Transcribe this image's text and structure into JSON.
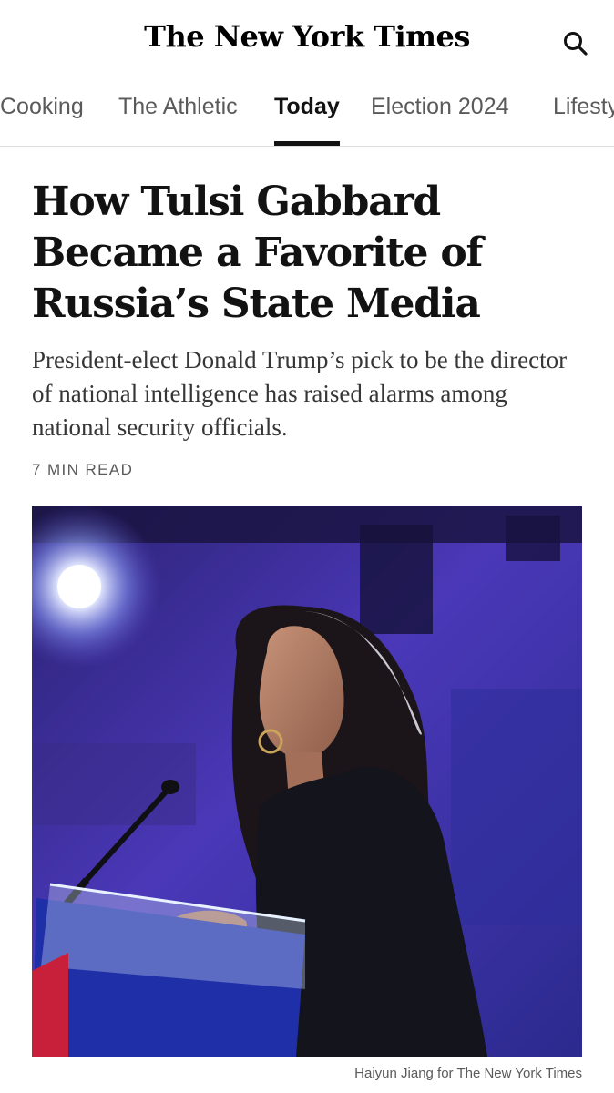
{
  "masthead": {
    "logo_text": "The New York Times",
    "search_icon": "search-icon"
  },
  "nav": {
    "tabs": [
      {
        "label": "Cooking",
        "active": false
      },
      {
        "label": "The Athletic",
        "active": false
      },
      {
        "label": "Today",
        "active": true
      },
      {
        "label": "Election 2024",
        "active": false
      },
      {
        "label": "Lifesty",
        "active": false
      }
    ]
  },
  "article": {
    "headline": "How Tulsi Gabbard Became a Favorite of Russia’s State Media",
    "summary": "President-elect Donald Trump’s pick to be the director of national intelligence has raised alarms among national security officials.",
    "read_time": "7 MIN READ",
    "photo_credit": "Haiyun Jiang for The New York Times"
  },
  "colors": {
    "text": "#121212",
    "secondary": "#5a5a5a",
    "divider": "#dcdcdc",
    "photo_background": "#3c2fa8"
  }
}
